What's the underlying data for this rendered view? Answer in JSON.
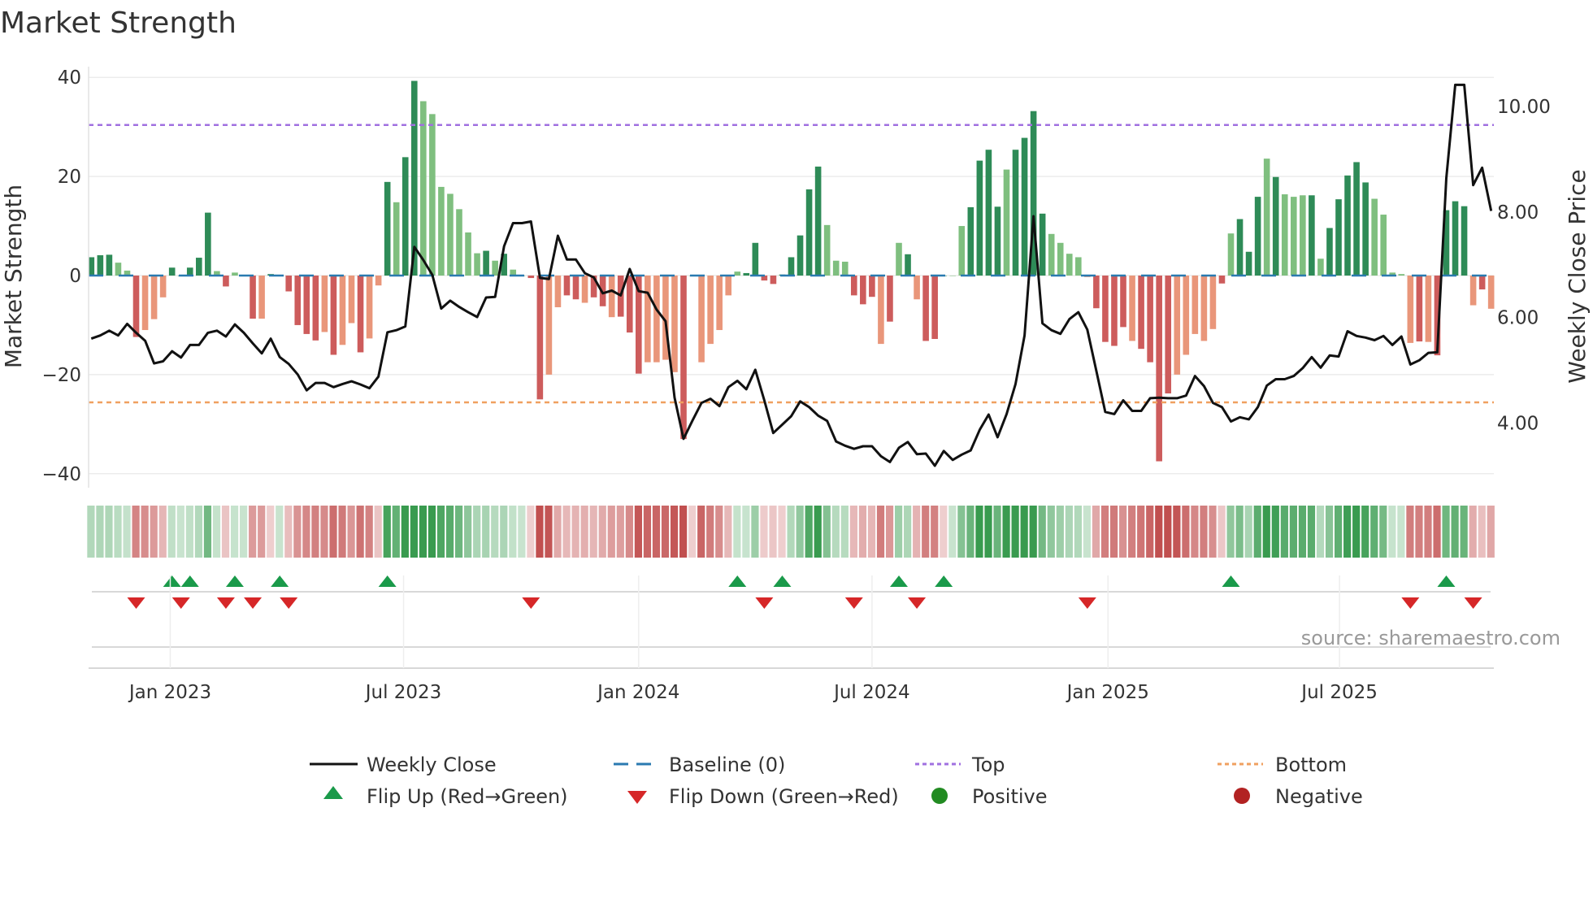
{
  "chart_data": {
    "type": "bar",
    "title": "Market Strength",
    "ylabel": "Market Strength",
    "ylabel_right": "Weekly Close Price",
    "ylim": [
      -40,
      40
    ],
    "ylim_right": [
      3.02,
      10.54
    ],
    "yticks": [
      "−40",
      "−20",
      "0",
      "20",
      "40"
    ],
    "ytick_values": [
      -40,
      -20,
      0,
      20,
      40
    ],
    "yticks_right": [
      "4.00",
      "6.00",
      "8.00",
      "10.00"
    ],
    "ytick_right_values": [
      4,
      6,
      8,
      10
    ],
    "xticks": [
      {
        "label": "Jan 2023",
        "week": 8.8
      },
      {
        "label": "Jul 2023",
        "week": 34.8
      },
      {
        "label": "Jan 2024",
        "week": 61
      },
      {
        "label": "Jul 2024",
        "week": 87
      },
      {
        "label": "Jan 2025",
        "week": 113.3
      },
      {
        "label": "Jul 2025",
        "week": 139.1
      }
    ],
    "top_level": 30.4,
    "bottom_level": -25.6,
    "strength": [
      3.7,
      4.1,
      4.2,
      2.6,
      1,
      -12.4,
      -11,
      -8.8,
      -4.4,
      1.6,
      0,
      1.6,
      3.6,
      12.7,
      0.9,
      -2.2,
      0.6,
      0,
      -8.7,
      -8.7,
      0.3,
      0,
      -3.2,
      -10,
      -11.8,
      -13.1,
      -11.4,
      -16,
      -14,
      -9.6,
      -15.5,
      -12.7,
      -2,
      18.9,
      14.8,
      23.9,
      39.3,
      35.2,
      32.6,
      17.9,
      16.5,
      13.4,
      8.7,
      4.5,
      5,
      3,
      4.4,
      1.2,
      0,
      -0.5,
      -25,
      -20,
      -6.4,
      -4,
      -4.8,
      -5.5,
      -4.4,
      -6.2,
      -8.4,
      -8.3,
      -11.5,
      -19.8,
      -17.5,
      -17.5,
      -17,
      -19.5,
      -33,
      0,
      -17.5,
      -13.8,
      -11,
      -4,
      0.8,
      0.5,
      6.6,
      -1,
      -1.7,
      0.2,
      3.7,
      8.1,
      17.4,
      22,
      10.2,
      3,
      2.8,
      -4,
      -5.8,
      -4.3,
      -13.8,
      -9.3,
      6.6,
      4.3,
      -4.8,
      -13.2,
      -12.8,
      0,
      0,
      10,
      13.8,
      23.2,
      25.4,
      13.9,
      21.4,
      25.4,
      27.8,
      33.2,
      12.5,
      8.4,
      6.6,
      4.4,
      3.7,
      -0.3,
      -6.6,
      -13.4,
      -14.2,
      -10.4,
      -13.2,
      -14.8,
      -17.5,
      -37.5,
      -23.8,
      -20,
      -16,
      -11.8,
      -13.2,
      -10.8,
      -1.6,
      8.5,
      11.4,
      4.8,
      15.9,
      23.6,
      19.9,
      16.4,
      15.9,
      16.2,
      16.2,
      3.4,
      9.6,
      15.4,
      20.2,
      22.9,
      18.8,
      15.5,
      12.3,
      0.6,
      0.3,
      -13.6,
      -13.3,
      -13.4,
      -16.1,
      13.2,
      15,
      14,
      -6,
      -2.8,
      -6.7
    ],
    "shade": "dddlldllldddddldlldlddddddldlldlldlddllllllldldlldd",
    "shade2": "llddlddldddllllddllllldddddddddllldddldldldddllddddlddd",
    "shade3": "dlllllddddlddddllllldldddldllldldddddllllldlddddldld",
    "weekly_close": [
      5.6,
      5.66,
      5.75,
      5.66,
      5.88,
      5.71,
      5.56,
      5.13,
      5.17,
      5.36,
      5.24,
      5.48,
      5.48,
      5.71,
      5.75,
      5.64,
      5.87,
      5.71,
      5.51,
      5.32,
      5.6,
      5.25,
      5.12,
      4.92,
      4.62,
      4.76,
      4.76,
      4.68,
      4.74,
      4.79,
      4.73,
      4.66,
      4.88,
      5.72,
      5.76,
      5.83,
      7.34,
      7.09,
      6.81,
      6.17,
      6.32,
      6.2,
      6.1,
      6.01,
      6.38,
      6.39,
      7.35,
      7.79,
      7.79,
      7.82,
      6.75,
      6.73,
      7.55,
      7.1,
      7.1,
      6.84,
      6.76,
      6.46,
      6.51,
      6.42,
      6.92,
      6.5,
      6.47,
      6.15,
      5.93,
      4.48,
      3.7,
      4.05,
      4.38,
      4.46,
      4.32,
      4.68,
      4.8,
      4.64,
      5.01,
      4.43,
      3.81,
      3.97,
      4.13,
      4.41,
      4.3,
      4.14,
      4.04,
      3.65,
      3.57,
      3.51,
      3.56,
      3.56,
      3.37,
      3.26,
      3.53,
      3.64,
      3.41,
      3.42,
      3.19,
      3.47,
      3.3,
      3.4,
      3.48,
      3.87,
      4.16,
      3.73,
      4.17,
      4.74,
      5.66,
      7.92,
      5.89,
      5.76,
      5.69,
      5.97,
      6.1,
      5.77,
      4.99,
      4.21,
      4.17,
      4.43,
      4.23,
      4.23,
      4.47,
      4.48,
      4.47,
      4.47,
      4.52,
      4.89,
      4.7,
      4.38,
      4.3,
      4.03,
      4.11,
      4.07,
      4.3,
      4.71,
      4.83,
      4.83,
      4.89,
      5.04,
      5.25,
      5.05,
      5.28,
      5.26,
      5.74,
      5.65,
      5.62,
      5.57,
      5.65,
      5.48,
      5.64,
      5.11,
      5.19,
      5.33,
      5.34,
      8.64,
      10.41,
      10.41,
      8.51,
      8.84,
      8.02
    ],
    "flip_up_weeks": [
      9,
      11,
      16,
      21,
      33,
      72,
      77,
      90,
      95,
      127,
      151
    ],
    "flip_down_weeks": [
      5,
      10,
      15,
      18,
      22,
      49,
      75,
      85,
      92,
      111,
      147,
      154
    ],
    "colors": {
      "pos_dark": "#2e8b57",
      "pos_light": "#7fbf7f",
      "neg_dark": "#cd5c5c",
      "neg_light": "#e9967a",
      "close": "#111111",
      "baseline": "#2a7ab0",
      "top": "#a070e0",
      "bottom": "#f0a060",
      "flip_up": "#1a9a4a",
      "flip_down": "#d62728",
      "positive": "#228b22",
      "negative": "#b22222"
    },
    "legend": {
      "close": "Weekly Close",
      "baseline": "Baseline (0)",
      "top": "Top",
      "bottom": "Bottom",
      "flip_up": "Flip Up (Red→Green)",
      "flip_down": "Flip Down (Green→Red)",
      "positive": "Positive",
      "negative": "Negative"
    },
    "legend_position": "bottom",
    "source": "source: sharemaestro.com"
  }
}
